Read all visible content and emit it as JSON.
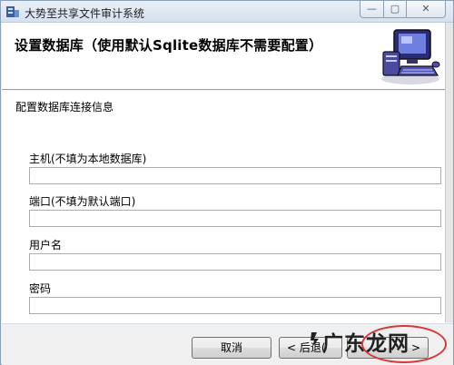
{
  "window": {
    "title": "大势至共享文件审计系统",
    "controls": {
      "minimize": "—",
      "maximize": "▢",
      "close": "✕"
    }
  },
  "header": {
    "title": "设置数据库（使用默认Sqlite数据库不需要配置）",
    "image_icon": "computer-workstation-icon"
  },
  "content": {
    "section_label": "配置数据库连接信息",
    "fields": [
      {
        "label": "主机(不填为本地数据库)",
        "value": ""
      },
      {
        "label": "端口(不填为默认端口)",
        "value": ""
      },
      {
        "label": "用户名",
        "value": ""
      },
      {
        "label": "密码",
        "value": ""
      }
    ]
  },
  "buttons": {
    "cancel": "取消",
    "back": "< 后退(",
    "next": ">"
  },
  "watermark": {
    "text": "广东龙网"
  },
  "colors": {
    "annotation": "#d83a3a",
    "header_bg": "#ffffff",
    "window_bg": "#f0f0f0"
  }
}
